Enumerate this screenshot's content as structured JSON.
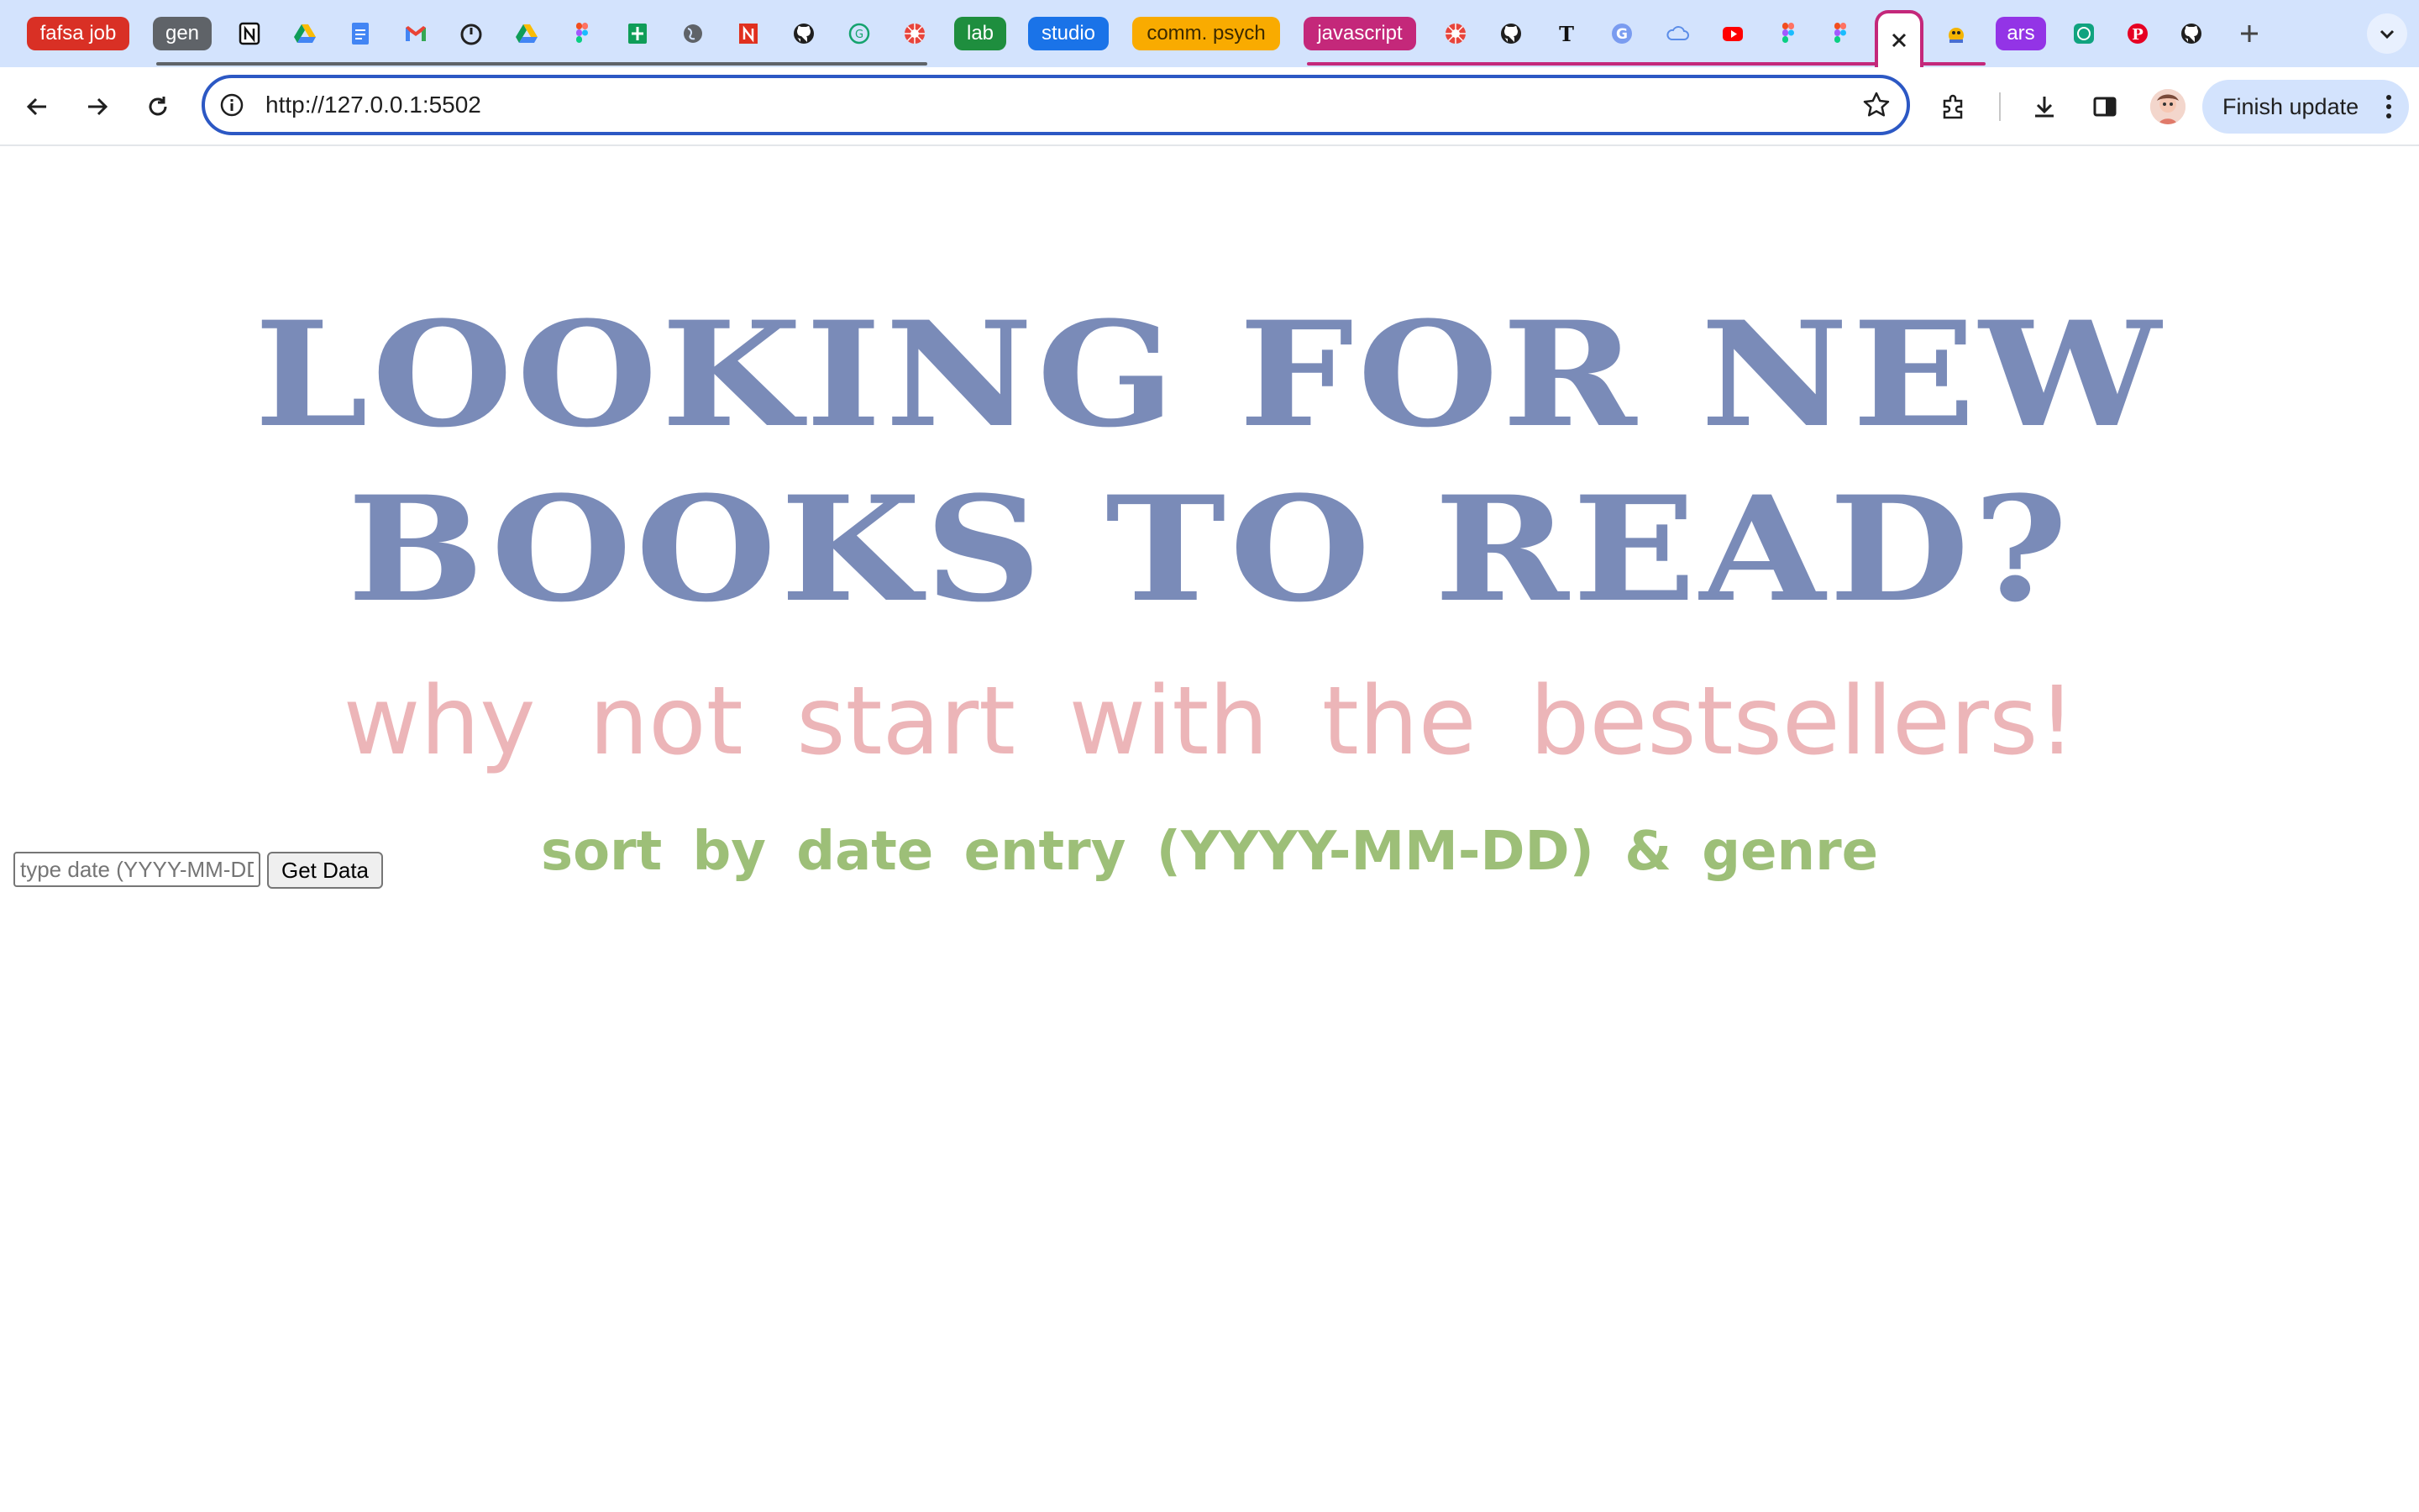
{
  "browser": {
    "tab_groups": [
      {
        "label": "fafsa job",
        "color": "#d93025"
      },
      {
        "label": "gen",
        "color": "#5f6368"
      },
      {
        "label": "lab",
        "color": "#1e8e3e"
      },
      {
        "label": "studio",
        "color": "#1a73e8"
      },
      {
        "label": "comm. psych",
        "color": "#f9ab00"
      },
      {
        "label": "javascript",
        "color": "#c4287a"
      },
      {
        "label": "ars",
        "color": "#9334e6"
      }
    ],
    "tabs": [
      {
        "icon": "notion-icon"
      },
      {
        "icon": "google-drive-icon"
      },
      {
        "icon": "google-docs-icon"
      },
      {
        "icon": "gmail-icon"
      },
      {
        "icon": "timer-icon"
      },
      {
        "icon": "google-drive-icon"
      },
      {
        "icon": "figma-icon"
      },
      {
        "icon": "google-sheets-icon"
      },
      {
        "icon": "globe-icon"
      },
      {
        "icon": "news-icon"
      },
      {
        "icon": "github-icon"
      },
      {
        "icon": "grammarly-icon"
      },
      {
        "icon": "wheel-icon"
      },
      {
        "icon": "wheel-icon"
      },
      {
        "icon": "github-icon"
      },
      {
        "icon": "nyt-icon"
      },
      {
        "icon": "google-icon"
      },
      {
        "icon": "cloud-icon"
      },
      {
        "icon": "youtube-icon"
      },
      {
        "icon": "figma-icon"
      },
      {
        "icon": "figma-icon"
      },
      {
        "icon": "close-icon"
      },
      {
        "icon": "bird-icon"
      },
      {
        "icon": "chatgpt-icon"
      },
      {
        "icon": "pinterest-icon"
      },
      {
        "icon": "github-icon"
      }
    ],
    "accent_color": "#2c58c4",
    "url": "http://127.0.0.1:5502",
    "finish_update_label": "Finish update"
  },
  "page": {
    "headline_line1": "LOOKING FOR NEW",
    "headline_line2": "BOOKS TO READ?",
    "subhead": "why not start with the bestsellers!",
    "sort_hint": "sort by date entry (YYYY-MM-DD) & genre",
    "date_input_placeholder": "type date (YYYY-MM-DD)",
    "date_input_value": "",
    "get_data_label": "Get Data",
    "colors": {
      "headline": "#7a8bb8",
      "subhead": "#ecb5b8",
      "sort_hint": "#9dbf78"
    }
  }
}
